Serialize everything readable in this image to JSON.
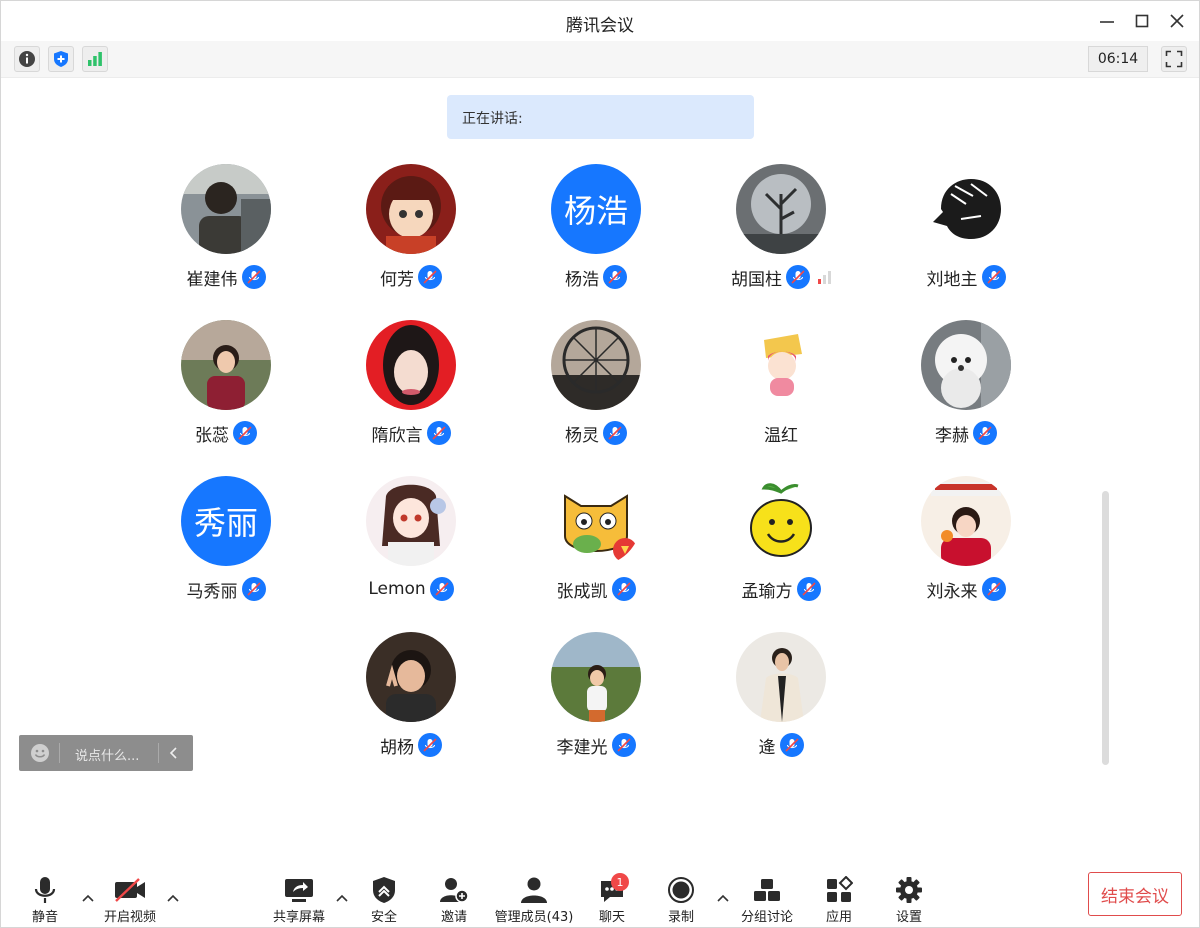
{
  "window": {
    "title": "腾讯会议"
  },
  "infobar": {
    "timer": "06:14"
  },
  "speaking": {
    "label": "正在讲话:"
  },
  "participants": [
    {
      "name": "崔建伟",
      "avatar": "photo-man-desk"
    },
    {
      "name": "何芳",
      "avatar": "cartoon-girl"
    },
    {
      "name": "杨浩",
      "avatar_text": "杨浩"
    },
    {
      "name": "胡国柱",
      "avatar": "photo-tree-art",
      "signal": true
    },
    {
      "name": "刘地主",
      "avatar": "lion-logo"
    },
    {
      "name": "张蕊",
      "avatar": "photo-woman-garden"
    },
    {
      "name": "隋欣言",
      "avatar": "photo-woman-portrait"
    },
    {
      "name": "杨灵",
      "avatar": "photo-ferris-wheel"
    },
    {
      "name": "温红",
      "avatar": "cartoon-chips-girl",
      "no_mic": true
    },
    {
      "name": "李赫",
      "avatar": "photo-white-poodle"
    },
    {
      "name": "马秀丽",
      "avatar_text": "秀丽"
    },
    {
      "name": "Lemon",
      "avatar": "anime-girl"
    },
    {
      "name": "张成凯",
      "avatar": "cartoon-cat"
    },
    {
      "name": "孟瑜方",
      "avatar": "cartoon-lemon"
    },
    {
      "name": "刘永来",
      "avatar": "photo-child-red"
    },
    {
      "name": "胡杨",
      "avatar": "photo-woman-peace"
    },
    {
      "name": "李建光",
      "avatar": "photo-child-outdoor"
    },
    {
      "name": "逄",
      "avatar": "photo-man-suit"
    }
  ],
  "chat": {
    "placeholder": "说点什么..."
  },
  "toolbar": {
    "mute": "静音",
    "video": "开启视频",
    "share": "共享屏幕",
    "security": "安全",
    "invite": "邀请",
    "members": "管理成员(43)",
    "chat": "聊天",
    "chat_badge": "1",
    "record": "录制",
    "breakout": "分组讨论",
    "apps": "应用",
    "settings": "设置",
    "end": "结束会议"
  },
  "colors": {
    "accent": "#1677ff",
    "end": "#e04c4c",
    "badge": "#f04848"
  }
}
